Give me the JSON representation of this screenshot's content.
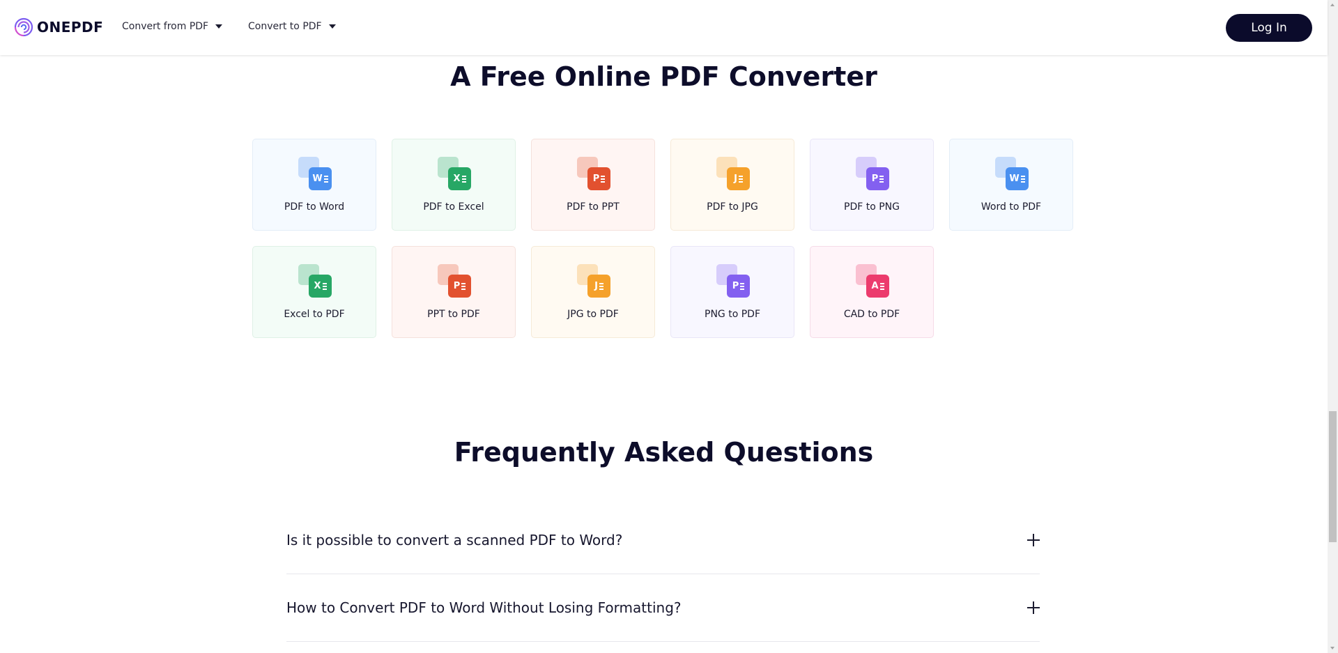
{
  "header": {
    "brand": "ONEPDF",
    "nav": [
      {
        "label": "Convert from PDF"
      },
      {
        "label": "Convert to PDF"
      }
    ],
    "login_label": "Log In"
  },
  "converter": {
    "title": "A Free Online PDF Converter",
    "tools": [
      {
        "label": "PDF to Word",
        "badge": "W",
        "icon": "pdf-to-word-icon",
        "color": "#4a90f0"
      },
      {
        "label": "PDF to Excel",
        "badge": "X",
        "icon": "pdf-to-excel-icon",
        "color": "#27a765"
      },
      {
        "label": "PDF to PPT",
        "badge": "P",
        "icon": "pdf-to-ppt-icon",
        "color": "#e2512f"
      },
      {
        "label": "PDF to JPG",
        "badge": "J",
        "icon": "pdf-to-jpg-icon",
        "color": "#f5a12b"
      },
      {
        "label": "PDF to PNG",
        "badge": "P",
        "icon": "pdf-to-png-icon",
        "color": "#8360f0"
      },
      {
        "label": "Word to PDF",
        "badge": "W",
        "icon": "word-to-pdf-icon",
        "color": "#4a90f0"
      },
      {
        "label": "Excel to PDF",
        "badge": "X",
        "icon": "excel-to-pdf-icon",
        "color": "#27a765"
      },
      {
        "label": "PPT to PDF",
        "badge": "P",
        "icon": "ppt-to-pdf-icon",
        "color": "#e2512f"
      },
      {
        "label": "JPG to PDF",
        "badge": "J",
        "icon": "jpg-to-pdf-icon",
        "color": "#f5a12b"
      },
      {
        "label": "PNG to PDF",
        "badge": "P",
        "icon": "png-to-pdf-icon",
        "color": "#8360f0"
      },
      {
        "label": "CAD to PDF",
        "badge": "A",
        "icon": "cad-to-pdf-icon",
        "color": "#ec3b6d"
      }
    ]
  },
  "faq": {
    "title": "Frequently Asked Questions",
    "items": [
      {
        "question": "Is it possible to convert a scanned PDF to Word?"
      },
      {
        "question": "How to Convert PDF to Word Without Losing Formatting?"
      }
    ]
  }
}
